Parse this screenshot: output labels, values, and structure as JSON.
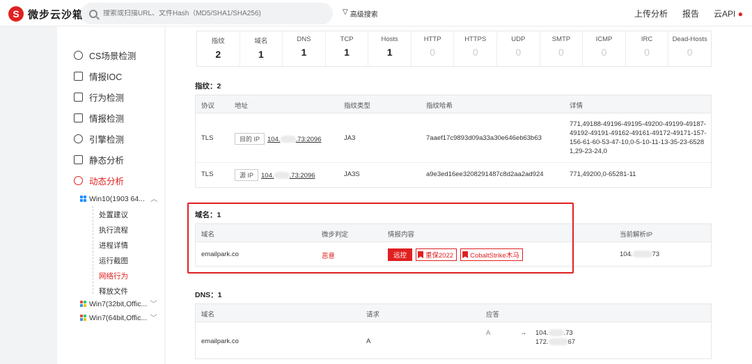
{
  "header": {
    "logo_text": "微步云沙箱",
    "search_placeholder": "搜索或扫描URL、文件Hash（MD5/SHA1/SHA256)",
    "advanced_search": "高级搜索",
    "nav": [
      "上传分析",
      "报告",
      "云API"
    ]
  },
  "sidebar": {
    "items": [
      {
        "label": "CS场景检测",
        "icon": "crosshair-icon"
      },
      {
        "label": "情报IOC",
        "icon": "checklist-icon"
      },
      {
        "label": "行为检测",
        "icon": "monitor-icon"
      },
      {
        "label": "情报检测",
        "icon": "grid-icon"
      },
      {
        "label": "引擎检测",
        "icon": "engine-icon"
      },
      {
        "label": "静态分析",
        "icon": "document-icon"
      },
      {
        "label": "动态分析",
        "icon": "dynamic-icon"
      }
    ],
    "envs": [
      "Win10(1903 64...",
      "Win7(32bit,Offic...",
      "Win7(64bit,Offic..."
    ],
    "sub_items": [
      "处置建议",
      "执行流程",
      "进程详情",
      "运行截图",
      "网络行为",
      "释放文件"
    ]
  },
  "stats": [
    {
      "label": "指纹",
      "value": "2"
    },
    {
      "label": "域名",
      "value": "1"
    },
    {
      "label": "DNS",
      "value": "1"
    },
    {
      "label": "TCP",
      "value": "1"
    },
    {
      "label": "Hosts",
      "value": "1"
    },
    {
      "label": "HTTP",
      "value": "0"
    },
    {
      "label": "HTTPS",
      "value": "0"
    },
    {
      "label": "UDP",
      "value": "0"
    },
    {
      "label": "SMTP",
      "value": "0"
    },
    {
      "label": "ICMP",
      "value": "0"
    },
    {
      "label": "IRC",
      "value": "0"
    },
    {
      "label": "Dead-Hosts",
      "value": "0"
    }
  ],
  "fingerprint": {
    "title": "指纹：2",
    "headers": [
      "协议",
      "地址",
      "指纹类型",
      "指纹哈希",
      "详情"
    ],
    "rows": [
      {
        "proto": "TLS",
        "ip_label": "目的 IP",
        "ip_a": "104.",
        "ip_b": ".73:2096",
        "type": "JA3",
        "hash": "7aaef17c9893d09a33a30e646eb63b63",
        "detail": "771,49188-49196-49195-49200-49199-49187-49192-49191-49162-49161-49172-49171-157-156-61-60-53-47-10,0-5-10-11-13-35-23-65281,29-23-24,0"
      },
      {
        "proto": "TLS",
        "ip_label": "源 IP",
        "ip_a": "104.",
        "ip_b": ".73:2096",
        "type": "JA3S",
        "hash": "a9e3ed16ee3208291487c8d2aa2ad924",
        "detail": "771,49200,0-65281-11"
      }
    ]
  },
  "domains": {
    "title": "域名：1",
    "headers": [
      "域名",
      "微步判定",
      "情报内容",
      "当前解析IP"
    ],
    "row": {
      "domain": "emailpark.co",
      "verdict": "恶意",
      "tag1": "远控",
      "tag2": "重保2022",
      "tag3": "CobaltStrike木马",
      "ip_a": "104.",
      "ip_b": "73"
    }
  },
  "dns": {
    "title": "DNS：1",
    "headers": [
      "域名",
      "请求",
      "应答"
    ],
    "row": {
      "domain": "emailpark.co",
      "request": "A",
      "answer_type": "A",
      "arrow": "→",
      "ans1_a": "104.",
      "ans1_b": ".73",
      "ans2_a": "172.",
      "ans2_b": "67"
    }
  }
}
